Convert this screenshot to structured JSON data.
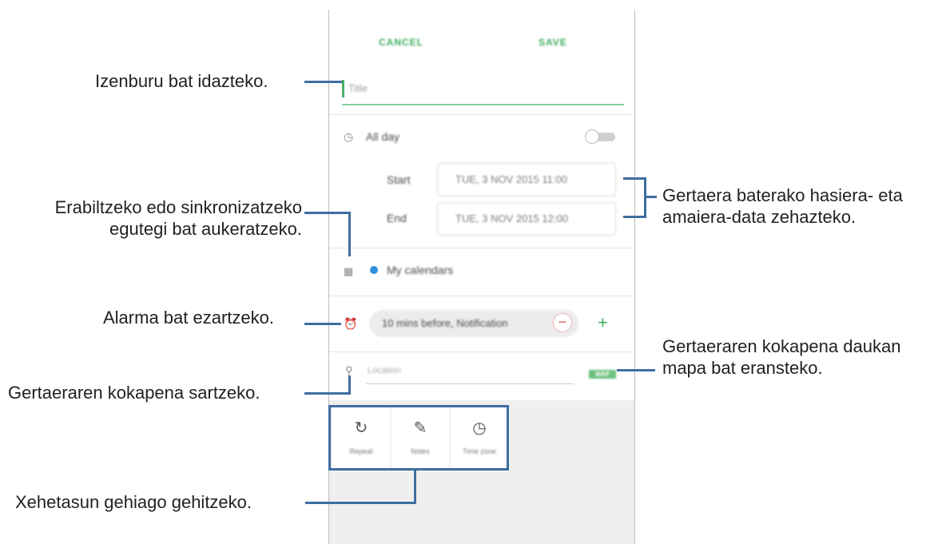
{
  "annotations": {
    "title": "Izenburu bat idazteko.",
    "calendar_line1": "Erabiltzeko edo sinkronizatzeko",
    "calendar_line2": "egutegi bat aukeratzeko.",
    "alarm": "Alarma bat ezartzeko.",
    "location": "Gertaeraren kokapena sartzeko.",
    "details": "Xehetasun gehiago gehitzeko.",
    "dates_line1": "Gertaera baterako hasiera- eta",
    "dates_line2": "amaiera-data zehazteko.",
    "map_line1": "Gertaeraren kokapena daukan",
    "map_line2": "mapa bat eransteko."
  },
  "phone": {
    "header": {
      "cancel_label": "CANCEL",
      "save_label": "SAVE"
    },
    "title_placeholder": "Title",
    "all_day": {
      "label": "All day",
      "toggle_on": false
    },
    "start": {
      "label": "Start",
      "value": "TUE, 3 NOV 2015   11:00"
    },
    "end": {
      "label": "End",
      "value": "TUE, 3 NOV 2015   12:00"
    },
    "calendar": {
      "name": "My calendars",
      "dot_color": "#2f8fdc"
    },
    "alarm": {
      "value": "10 mins before, Notification"
    },
    "location": {
      "placeholder": "Location",
      "map_label": "MAP"
    },
    "details_buttons": [
      {
        "label": "Repeat",
        "icon": "repeat-icon"
      },
      {
        "label": "Notes",
        "icon": "notes-icon"
      },
      {
        "label": "Time zone",
        "icon": "time-zone-icon"
      }
    ]
  },
  "colors": {
    "accent_green": "#3fae5e",
    "callout_line": "#3d6ea0"
  }
}
